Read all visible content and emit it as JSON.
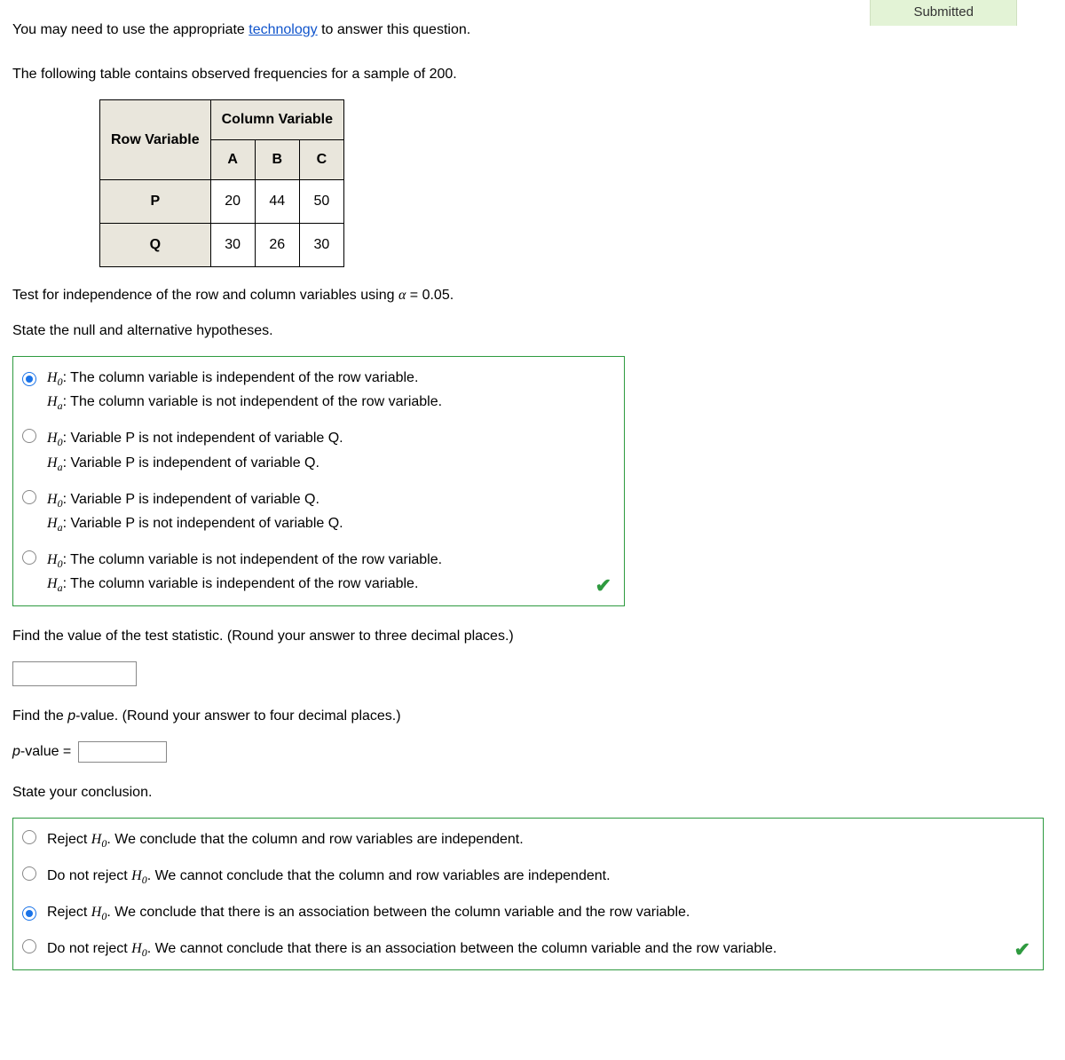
{
  "badge": "Submitted",
  "intro": {
    "prefix": "You may need to use the appropriate ",
    "link": "technology",
    "suffix": " to answer this question."
  },
  "table_intro": "The following table contains observed frequencies for a sample of 200.",
  "table": {
    "row_header": "Row Variable",
    "col_header": "Column Variable",
    "cols": [
      "A",
      "B",
      "C"
    ],
    "rows": [
      {
        "label": "P",
        "vals": [
          "20",
          "44",
          "50"
        ]
      },
      {
        "label": "Q",
        "vals": [
          "30",
          "26",
          "30"
        ]
      }
    ]
  },
  "test_line": {
    "prefix": "Test for independence of the row and column variables using ",
    "alpha": "α",
    "eq": " = 0.05."
  },
  "q1": {
    "prompt": "State the null and alternative hypotheses.",
    "options": [
      {
        "selected": true,
        "h0": "The column variable is independent of the row variable.",
        "ha": "The column variable is not independent of the row variable."
      },
      {
        "selected": false,
        "h0": "Variable P is not independent of variable Q.",
        "ha": "Variable P is independent of variable Q."
      },
      {
        "selected": false,
        "h0": "Variable P is independent of variable Q.",
        "ha": "Variable P is not independent of variable Q."
      },
      {
        "selected": false,
        "h0": "The column variable is not independent of the row variable.",
        "ha": "The column variable is independent of the row variable."
      }
    ]
  },
  "q2": {
    "prompt": "Find the value of the test statistic. (Round your answer to three decimal places.)"
  },
  "q3": {
    "prompt": "Find the ",
    "pv": "p",
    "prompt2": "-value. (Round your answer to four decimal places.)",
    "label": "-value = "
  },
  "q4": {
    "prompt": "State your conclusion.",
    "options": [
      {
        "selected": false,
        "prefix": "Reject ",
        "rest": ". We conclude that the column and row variables are independent."
      },
      {
        "selected": false,
        "prefix": "Do not reject ",
        "rest": ". We cannot conclude that the column and row variables are independent."
      },
      {
        "selected": true,
        "prefix": "Reject ",
        "rest": ". We conclude that there is an association between the column variable and the row variable."
      },
      {
        "selected": false,
        "prefix": "Do not reject ",
        "rest": ". We cannot conclude that there is an association between the column variable and the row variable."
      }
    ]
  },
  "labels": {
    "h0": "H",
    "h0sub": "0",
    "ha": "H",
    "hasub": "a"
  }
}
